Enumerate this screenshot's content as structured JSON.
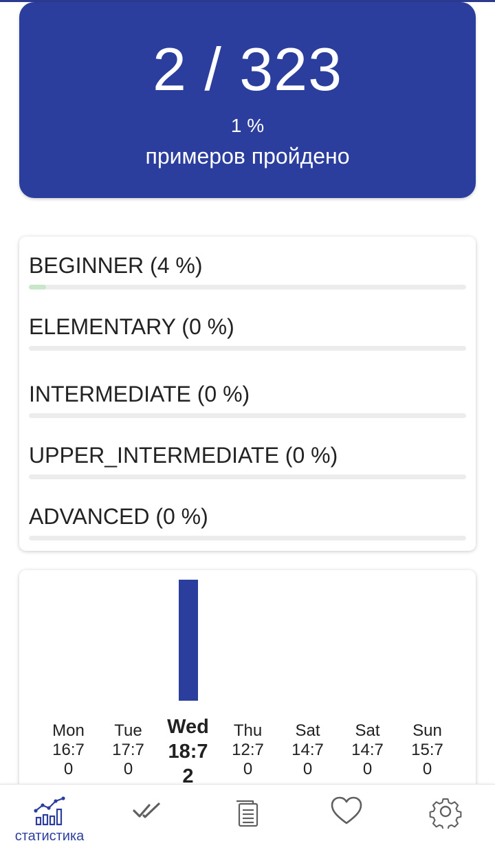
{
  "colors": {
    "accent": "#2c3e9d",
    "progress_fill": "#c8e6c9",
    "track": "#ececec",
    "icon_gray": "#5f5f5f"
  },
  "summary": {
    "count_text": "2 / 323",
    "percent_text": "1 %",
    "caption": "примеров пройдено"
  },
  "levels": [
    {
      "label": "BEGINNER (4 %)",
      "progress": 0.04
    },
    {
      "label": "ELEMENTARY (0 %)",
      "progress": 0
    },
    {
      "label": "INTERMEDIATE (0 %)",
      "progress": 0
    },
    {
      "label": "UPPER_INTERMEDIATE (0 %)",
      "progress": 0
    },
    {
      "label": "ADVANCED (0 %)",
      "progress": 0
    }
  ],
  "chart_data": {
    "type": "bar",
    "categories": [
      "Mon\n16:7\n0",
      "Tue\n17:7\n0",
      "Wed\n18:7\n2",
      "Thu\n12:7\n0",
      "Sat\n14:7\n0",
      "Sat\n14:7\n0",
      "Sun\n15:7\n0"
    ],
    "values": [
      0,
      0,
      2,
      0,
      0,
      0,
      0
    ],
    "current_index": 2,
    "days": [
      {
        "line1": "Mon",
        "line2": "16:7",
        "line3": "0"
      },
      {
        "line1": "Tue",
        "line2": "17:7",
        "line3": "0"
      },
      {
        "line1": "Wed",
        "line2": "18:7",
        "line3": "2"
      },
      {
        "line1": "Thu",
        "line2": "12:7",
        "line3": "0"
      },
      {
        "line1": "Sat",
        "line2": "14:7",
        "line3": "0"
      },
      {
        "line1": "Sat",
        "line2": "14:7",
        "line3": "0"
      },
      {
        "line1": "Sun",
        "line2": "15:7",
        "line3": "0"
      }
    ],
    "title": "",
    "xlabel": "",
    "ylabel": "",
    "grid": false
  },
  "bottom_nav": {
    "selected_index": 0,
    "items": [
      {
        "icon": "statistics-icon",
        "label": "статистика"
      },
      {
        "icon": "double-check-icon",
        "label": ""
      },
      {
        "icon": "documents-icon",
        "label": ""
      },
      {
        "icon": "heart-icon",
        "label": ""
      },
      {
        "icon": "gear-icon",
        "label": ""
      }
    ]
  }
}
